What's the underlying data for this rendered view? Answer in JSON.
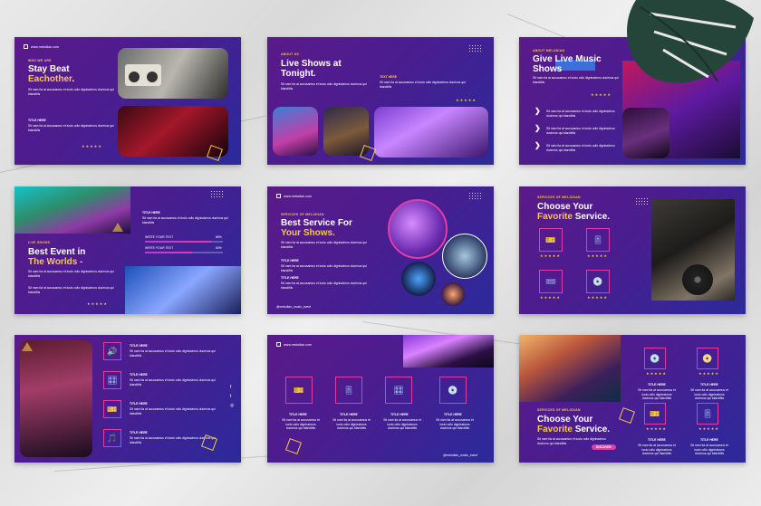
{
  "brand": {
    "url": "www.melodian.com",
    "social": "@melodian_music_event"
  },
  "lorem": "Sit nam ita at accusamus et iusto odio dignissimos ducimus qui blanditiis",
  "slide1": {
    "kicker": "WHO WE ARE",
    "title_a": "Stay Beat",
    "title_b": "Eachother",
    "sub": "TITLE HERE",
    "stars": "★★★★★"
  },
  "slide2": {
    "kicker": "ABOUT US",
    "title": "Live Shows at Tonight.",
    "sub": "TEXT HERE",
    "stars": "★★★★★"
  },
  "slide3": {
    "kicker": "ABOUT MELODIAN",
    "title": "Give Live Music Shows",
    "stars": "★★★★★"
  },
  "slide4": {
    "kicker": "LIVE SHOWS",
    "title_a": "Best Event in",
    "title_b": "The Worlds -",
    "sub": "TITLE HERE",
    "bars": [
      {
        "label": "WRITE YOUR TEXT",
        "pct": "85%",
        "value": 0.85
      },
      {
        "label": "WRITE YOUR TEXT",
        "pct": "60%",
        "value": 0.6
      }
    ],
    "stars": "★★★★★"
  },
  "slide5": {
    "kicker": "SERVICES OF MELODIAN",
    "title_a": "Best Service For",
    "title_b": "Your Shows.",
    "sub1": "TITLE HERE",
    "sub2": "TITLE HERE"
  },
  "slide6": {
    "kicker": "SERVICES OF MELODIAN",
    "title_a": "Choose Your",
    "title_b": "Favorite",
    "title_c": "Service.",
    "stars": "★★★★★"
  },
  "slide7": {
    "items": [
      "TITLE HERE",
      "TITLE HERE",
      "TITLE HERE",
      "TITLE HERE"
    ]
  },
  "slide8": {
    "items": [
      "TITLE HERE",
      "TITLE HERE",
      "TITLE HERE",
      "TITLE HERE"
    ],
    "stars": "★★★★★"
  },
  "slide9": {
    "kicker": "SERVICES OF MELODIAN",
    "title_a": "Choose Your",
    "title_b": "Favorite",
    "title_c": "Service.",
    "button": "DISCOVER",
    "items": [
      "TITLE HERE",
      "TITLE HERE",
      "TITLE HERE",
      "TITLE HERE"
    ],
    "stars": "★★★★★"
  }
}
